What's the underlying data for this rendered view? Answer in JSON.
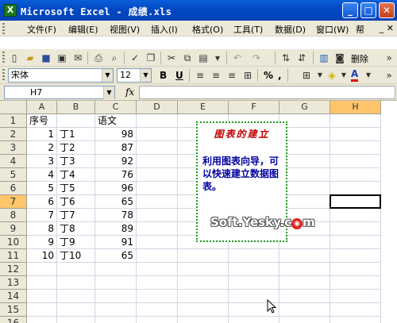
{
  "window": {
    "title": "Microsoft Excel - 成绩.xls",
    "app_icon": "X",
    "minimize": "_",
    "maximize": "□",
    "close": "✕"
  },
  "menu": {
    "items": [
      "文件(F)",
      "编辑(E)",
      "视图(V)",
      "插入(I)",
      "格式(O)",
      "工具(T)",
      "数据(D)",
      "窗口(W)",
      "帮"
    ],
    "right_controls": "_ ✕"
  },
  "toolbar": {
    "delete_label": "删除"
  },
  "format_toolbar": {
    "font": "宋体",
    "size": "12",
    "bold": "B",
    "underline": "U",
    "percent": "%",
    "comma": ",",
    "font_color_label": "A"
  },
  "formula_bar": {
    "name_box": "H7",
    "fx": "fx",
    "content": ""
  },
  "columns": [
    "A",
    "B",
    "C",
    "D",
    "E",
    "F",
    "G",
    "H"
  ],
  "active_column": "H",
  "rows": [
    "1",
    "2",
    "3",
    "4",
    "5",
    "6",
    "7",
    "8",
    "9",
    "10",
    "11",
    "12",
    "13",
    "14",
    "15",
    "16"
  ],
  "active_row": "7",
  "sheet": {
    "header": {
      "a": "序号",
      "c": "语文"
    },
    "data": [
      {
        "a": "1",
        "b": "丁1",
        "c": "98"
      },
      {
        "a": "2",
        "b": "丁2",
        "c": "87"
      },
      {
        "a": "3",
        "b": "丁3",
        "c": "92"
      },
      {
        "a": "4",
        "b": "丁4",
        "c": "76"
      },
      {
        "a": "5",
        "b": "丁5",
        "c": "96"
      },
      {
        "a": "6",
        "b": "丁6",
        "c": "65"
      },
      {
        "a": "7",
        "b": "丁7",
        "c": "78"
      },
      {
        "a": "8",
        "b": "丁8",
        "c": "89"
      },
      {
        "a": "9",
        "b": "丁9",
        "c": "91"
      },
      {
        "a": "10",
        "b": "丁10",
        "c": "65"
      }
    ]
  },
  "annotation": {
    "title": "图表的建立",
    "body": "利用图表向导，可以快速建立数据图表。"
  },
  "watermark": {
    "text": "Soft.Yesky.c",
    "badge": "◉",
    "suffix": "m"
  }
}
